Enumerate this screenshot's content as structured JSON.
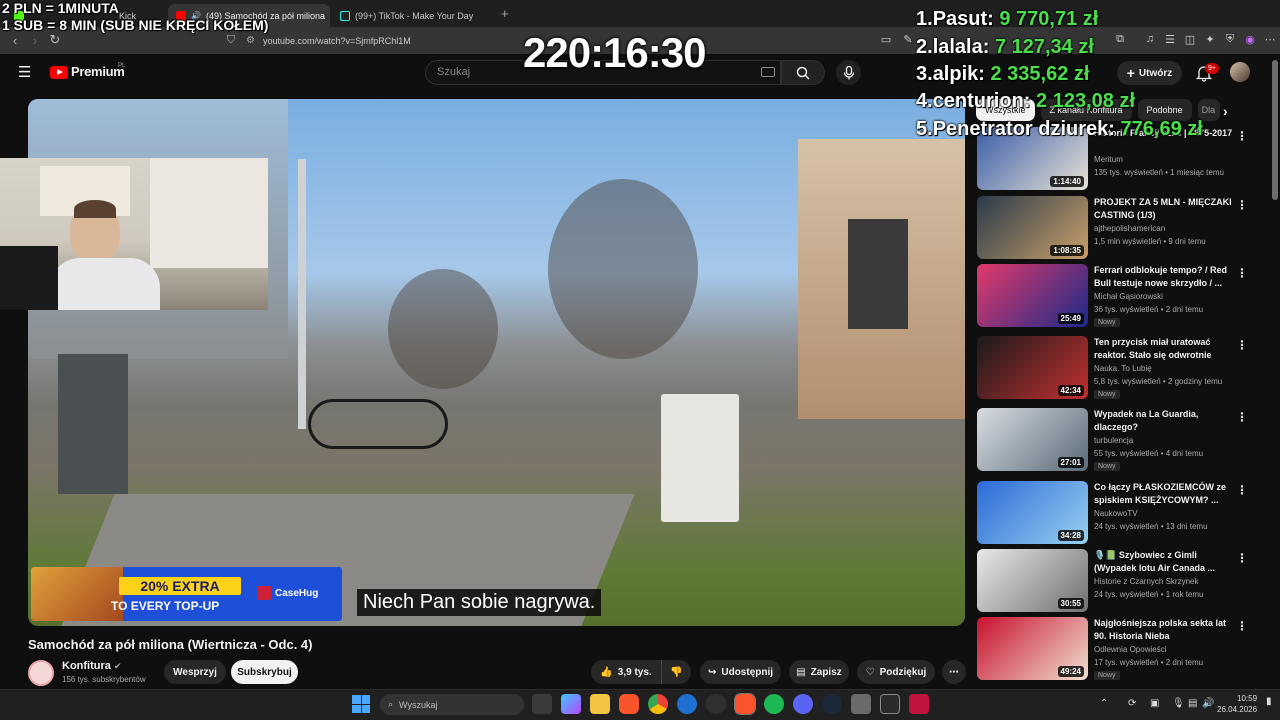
{
  "overlay": {
    "line1": "2 PLN =  1MINUTA",
    "line2": "1 SUB = 8 MIN (SUB NIE KRĘCI KOŁEM)",
    "timer": "220:16:30",
    "leaderboard": [
      {
        "rank": "1.",
        "name": "Pasut:",
        "amount": "9 770,71 zł"
      },
      {
        "rank": "2.",
        "name": "lalala:",
        "amount": "7 127,34 zł"
      },
      {
        "rank": "3.",
        "name": "alpik:",
        "amount": "2 335,62 zł"
      },
      {
        "rank": "4.",
        "name": "centurion:",
        "amount": "2 123,08 zł"
      },
      {
        "rank": "5.",
        "name": "Penetrator dziurek:",
        "amount": "776,69 zł"
      }
    ]
  },
  "browser": {
    "tabs": [
      {
        "label": "Kick",
        "active": false
      },
      {
        "label": "(49) Samochód za pół miliona",
        "active": true
      },
      {
        "label": "(99+) TikTok - Make Your Day",
        "active": false
      }
    ],
    "url": "youtube.com/watch?v=SjmfpRChl1M"
  },
  "header": {
    "logo": "Premium",
    "logo_region": "PL",
    "search_placeholder": "Szukaj",
    "create_label": "Utwórz",
    "notification_count": "9+"
  },
  "player": {
    "subtitle": "Niech Pan sobie nagrywa.",
    "ad_line1": "20% EXTRA",
    "ad_line2": "TO EVERY TOP-UP",
    "ad_brand": "CaseHug"
  },
  "video": {
    "title": "Samochód za pół miliona (Wiertnicza - Odc. 4)",
    "channel": "Konfitura",
    "subscribers": "156 tys. subskrybentów",
    "support_label": "Wesprzyj",
    "subscribe_label": "Subskrybuj",
    "likes": "3,9 tys.",
    "share_label": "Udostępnij",
    "save_label": "Zapisz",
    "thanks_label": "Podziękuj"
  },
  "sidebar": {
    "chips": [
      "Wszystkie",
      "Z kanału Konfitura",
      "Podobne",
      "Dla"
    ],
    "recommendations": [
      {
        "title": "Historia Francji cz. 3 | 1875-2017",
        "channel": "Meritum",
        "meta": "135 tys. wyświetleń • 1 miesiąc temu",
        "duration": "1:14:40",
        "new": "",
        "colors": [
          "#3b5da8",
          "#e8e2d6"
        ]
      },
      {
        "title": "PROJEKT ZA 5 MLN - MIĘCZAKI CASTING (1/3)",
        "channel": "ajthepolishamerican",
        "meta": "1,5 mln wyświetleń • 9 dni temu",
        "duration": "1:08:35",
        "new": "",
        "colors": [
          "#2a3a4a",
          "#c9a06a"
        ]
      },
      {
        "title": "Ferrari odblokuje tempo? / Red Bull testuje nowe skrzydło / ...",
        "channel": "Michał Gąsiorowski",
        "meta": "36 tys. wyświetleń • 2 dni temu",
        "duration": "25:49",
        "new": "Nowy",
        "colors": [
          "#e23a6a",
          "#1b2a8a"
        ]
      },
      {
        "title": "Ten przycisk miał uratować reaktor. Stało się odwrotnie",
        "channel": "Nauka. To Lubię",
        "meta": "5,8 tys. wyświetleń • 2 godziny temu",
        "duration": "42:34",
        "new": "Nowy",
        "colors": [
          "#1a1a1a",
          "#c23030"
        ]
      },
      {
        "title": "Wypadek na La Guardia, dlaczego?",
        "channel": "turbulencja",
        "meta": "55 tys. wyświetleń • 4 dni temu",
        "duration": "27:01",
        "new": "Nowy",
        "colors": [
          "#d8dde2",
          "#5a6a78"
        ]
      },
      {
        "title": "Co łączy PŁASKOZIEMCÓW ze spiskiem KSIĘŻYCOWYM? ...",
        "channel": "NaukowoTV",
        "meta": "24 tys. wyświetleń • 13 dni temu",
        "duration": "34:28",
        "new": "",
        "colors": [
          "#2a6ad8",
          "#9ad0f0"
        ]
      },
      {
        "title": "🎙️📗 Szybowiec z Gimli (Wypadek lotu Air Canada ...",
        "channel": "Historie z Czarnych Skrzynek",
        "meta": "24 tys. wyświetleń • 1 rok temu",
        "duration": "30:55",
        "new": "",
        "colors": [
          "#e8e8e8",
          "#707070"
        ]
      },
      {
        "title": "Najgłośniejsza polska sekta lat 90. Historia Nieba",
        "channel": "Odlewnia Opowieści",
        "meta": "17 tys. wyświetleń • 2 dni temu",
        "duration": "49:24",
        "new": "Nowy",
        "colors": [
          "#c8102e",
          "#f0e0d0"
        ]
      }
    ]
  },
  "taskbar": {
    "search_placeholder": "Wyszukaj",
    "time": "10:59",
    "date": "26.04.2026"
  }
}
